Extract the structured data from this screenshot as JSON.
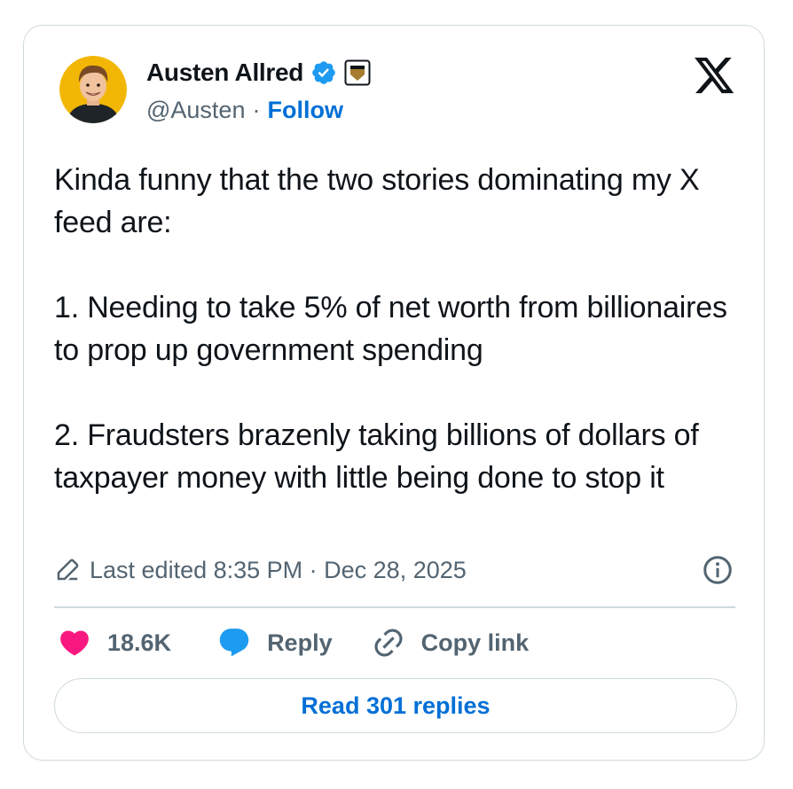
{
  "author": {
    "display_name": "Austen Allred",
    "handle": "@Austen",
    "separator": "·",
    "follow_label": "Follow",
    "verified_icon": "verified-badge-icon",
    "affiliation_icon": "affiliate-badge-icon",
    "avatar_icon": "avatar"
  },
  "tweet": {
    "paragraphs": [
      "Kinda funny that the two stories dominating my X feed are:",
      "1. Needing to take 5% of net worth from billionaires to prop up government spending",
      "2. Fraudsters brazenly taking billions of dollars of taxpayer money with little being done to stop it"
    ],
    "edited_label": "Last edited 8:35 PM · Dec 28, 2025"
  },
  "actions": {
    "like_count": "18.6K",
    "reply_label": "Reply",
    "copy_link_label": "Copy link"
  },
  "read_replies_label": "Read 301 replies",
  "colors": {
    "like": "#f91880",
    "reply": "#1d9bf0",
    "link": "#006fd6",
    "muted": "#536471",
    "border": "#cfd9de",
    "verified": "#1d9bf0"
  }
}
